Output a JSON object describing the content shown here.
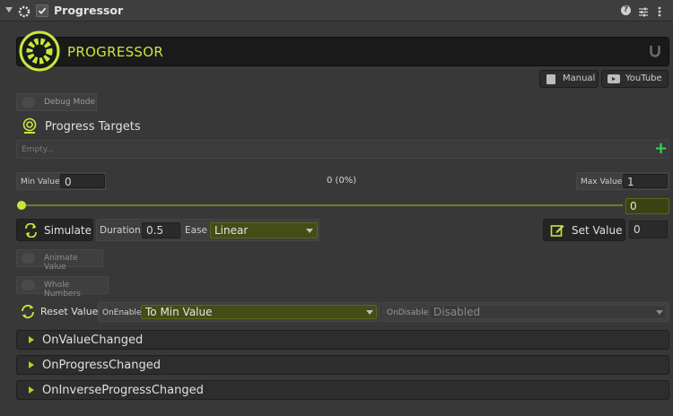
{
  "header": {
    "title": "Progressor",
    "enabled": true
  },
  "banner": {
    "title": "PROGRESSOR"
  },
  "links": {
    "manual": "Manual",
    "youtube": "YouTube"
  },
  "debug": {
    "label": "Debug Mode"
  },
  "targets": {
    "title": "Progress Targets",
    "empty": "Empty...",
    "add": "+"
  },
  "range": {
    "min_label": "Min Value",
    "min_value": "0",
    "status": "0 (0%)",
    "max_label": "Max Value",
    "max_value": "1",
    "slider_value": "0",
    "slider_fraction": 0
  },
  "simulate": {
    "button": "Simulate",
    "duration_label": "Duration",
    "duration_value": "0.5",
    "ease_label": "Ease",
    "ease_value": "Linear"
  },
  "set_value": {
    "button": "Set Value",
    "value": "0"
  },
  "options": {
    "animate": "Animate Value",
    "whole": "Whole Numbers"
  },
  "reset": {
    "label": "Reset Value",
    "on_enable_label": "OnEnable",
    "on_enable_value": "To Min Value",
    "on_disable_label": "OnDisable",
    "on_disable_value": "Disabled"
  },
  "events": [
    {
      "label": "OnValueChanged"
    },
    {
      "label": "OnProgressChanged"
    },
    {
      "label": "OnInverseProgressChanged"
    }
  ],
  "colors": {
    "accent": "#c5e83c",
    "add": "#39d35c"
  }
}
